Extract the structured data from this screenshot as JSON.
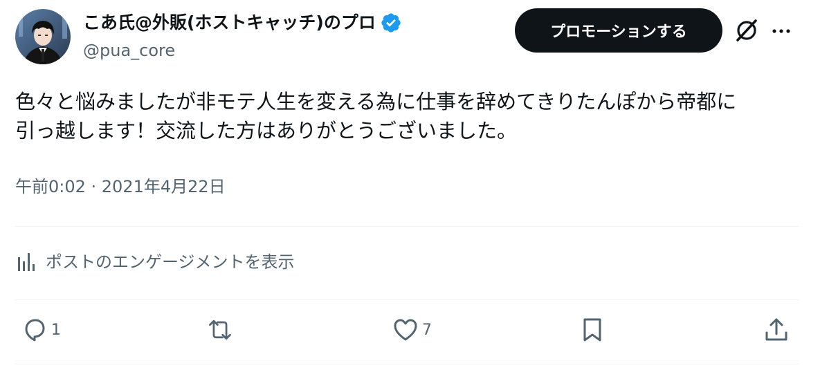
{
  "author": {
    "display_name": "こあ氏@外販(ホストキャッチ)のプロ",
    "handle": "@pua_core",
    "verified": true
  },
  "header": {
    "promote_label": "プロモーションする"
  },
  "tweet": {
    "text": "色々と悩みましたが非モテ人生を変える為に仕事を辞めてきりたんぽから帝都に\n引っ越します！交流した方はありがとうございました。",
    "timestamp": "午前0:02 · 2021年4月22日"
  },
  "engagement": {
    "label": "ポストのエンゲージメントを表示"
  },
  "actions": {
    "reply_count": "1",
    "retweet_count": "",
    "like_count": "7"
  },
  "colors": {
    "text": "#0f1419",
    "secondary": "#536471",
    "verified": "#1d9bf0",
    "divider": "#eff3f4",
    "button_bg": "#0f1419"
  }
}
